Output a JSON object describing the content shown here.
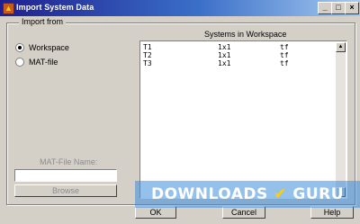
{
  "window": {
    "title": "Import System Data",
    "icon": "matlab-logo-icon",
    "controls": {
      "minimize": "_",
      "maximize": "□",
      "close": "×"
    }
  },
  "import_from": {
    "legend": "Import from",
    "options": [
      {
        "label": "Workspace",
        "checked": true
      },
      {
        "label": "MAT-file",
        "checked": false
      }
    ]
  },
  "systems": {
    "header": "Systems in Workspace",
    "rows": [
      {
        "name": "T1",
        "size": "1x1",
        "type": "tf"
      },
      {
        "name": "T2",
        "size": "1x1",
        "type": "tf"
      },
      {
        "name": "T3",
        "size": "1x1",
        "type": "tf"
      }
    ]
  },
  "matfile": {
    "label": "MAT-File Name:",
    "value": "",
    "browse_label": "Browse"
  },
  "buttons": {
    "ok": "OK",
    "cancel": "Cancel",
    "help": "Help"
  },
  "watermark": {
    "text_left": "DOWNLOADS",
    "text_right": "GURU"
  },
  "colors": {
    "titlebar_start": "#1f1f8f",
    "titlebar_end": "#a6caf0",
    "face": "#d4d0c8"
  }
}
